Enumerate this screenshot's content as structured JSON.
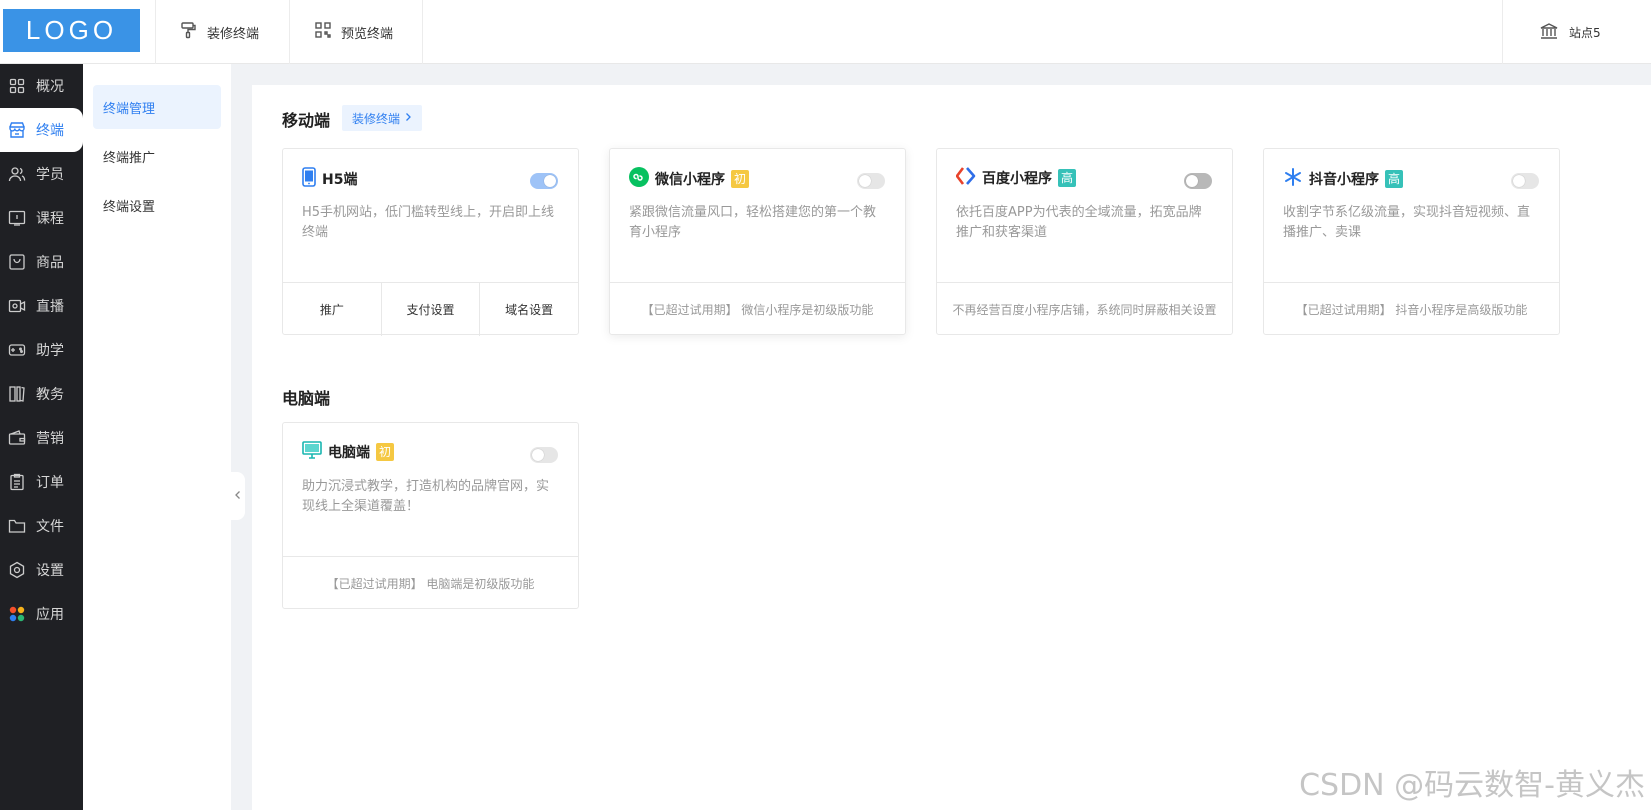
{
  "header": {
    "logo": "LOGO",
    "nav": [
      {
        "label": "装修终端",
        "icon": "paint-roller-icon"
      },
      {
        "label": "预览终端",
        "icon": "qr-code-icon"
      }
    ],
    "site": {
      "label": "站点5",
      "icon": "bank-icon"
    }
  },
  "sidebar": {
    "items": [
      {
        "label": "概况",
        "icon": "dashboard-icon"
      },
      {
        "label": "终端",
        "icon": "store-icon",
        "active": true
      },
      {
        "label": "学员",
        "icon": "users-icon"
      },
      {
        "label": "课程",
        "icon": "course-icon"
      },
      {
        "label": "商品",
        "icon": "product-icon"
      },
      {
        "label": "直播",
        "icon": "live-icon"
      },
      {
        "label": "助学",
        "icon": "gamepad-icon"
      },
      {
        "label": "教务",
        "icon": "book-icon"
      },
      {
        "label": "营销",
        "icon": "wallet-icon"
      },
      {
        "label": "订单",
        "icon": "clipboard-icon"
      },
      {
        "label": "文件",
        "icon": "folder-icon"
      },
      {
        "label": "设置",
        "icon": "settings-icon"
      },
      {
        "label": "应用",
        "icon": "apps-icon"
      }
    ]
  },
  "subnav": {
    "items": [
      {
        "label": "终端管理",
        "active": true
      },
      {
        "label": "终端推广"
      },
      {
        "label": "终端设置"
      }
    ]
  },
  "mobile": {
    "title": "移动端",
    "decorate_link": "装修终端",
    "cards": [
      {
        "name": "H5端",
        "icon": "phone-icon",
        "badge": "",
        "enabled": true,
        "desc": "H5手机网站，低门槛转型线上，开启即上线终端",
        "actions": [
          "推广",
          "支付设置",
          "域名设置"
        ],
        "footer": ""
      },
      {
        "name": "微信小程序",
        "icon": "wechat-mini-icon",
        "badge": "初",
        "enabled": false,
        "desc": "紧跟微信流量风口，轻松搭建您的第一个教育小程序",
        "actions": [],
        "footer": "【已超过试用期】 微信小程序是初级版功能"
      },
      {
        "name": "百度小程序",
        "icon": "baidu-mini-icon",
        "badge": "高",
        "enabled": false,
        "desc": "依托百度APP为代表的全域流量，拓宽品牌推广和获客渠道",
        "actions": [],
        "footer": "不再经营百度小程序店铺，系统同时屏蔽相关设置"
      },
      {
        "name": "抖音小程序",
        "icon": "douyin-mini-icon",
        "badge": "高",
        "enabled": false,
        "desc": "收割字节系亿级流量，实现抖音短视频、直播推广、卖课",
        "actions": [],
        "footer": "【已超过试用期】 抖音小程序是高级版功能"
      }
    ]
  },
  "pc": {
    "title": "电脑端",
    "cards": [
      {
        "name": "电脑端",
        "icon": "monitor-icon",
        "badge": "初",
        "enabled": false,
        "desc": "助力沉浸式教学，打造机构的品牌官网，实现线上全渠道覆盖！",
        "footer": "【已超过试用期】 电脑端是初级版功能"
      }
    ]
  },
  "watermark": "CSDN @码云数智-黄义杰",
  "colors": {
    "accent": "#2f7ff0",
    "logo": "#3a93e6",
    "sidebar": "#1f2024",
    "badge_chu": "#f5c842",
    "badge_gao": "#36c1b8"
  }
}
